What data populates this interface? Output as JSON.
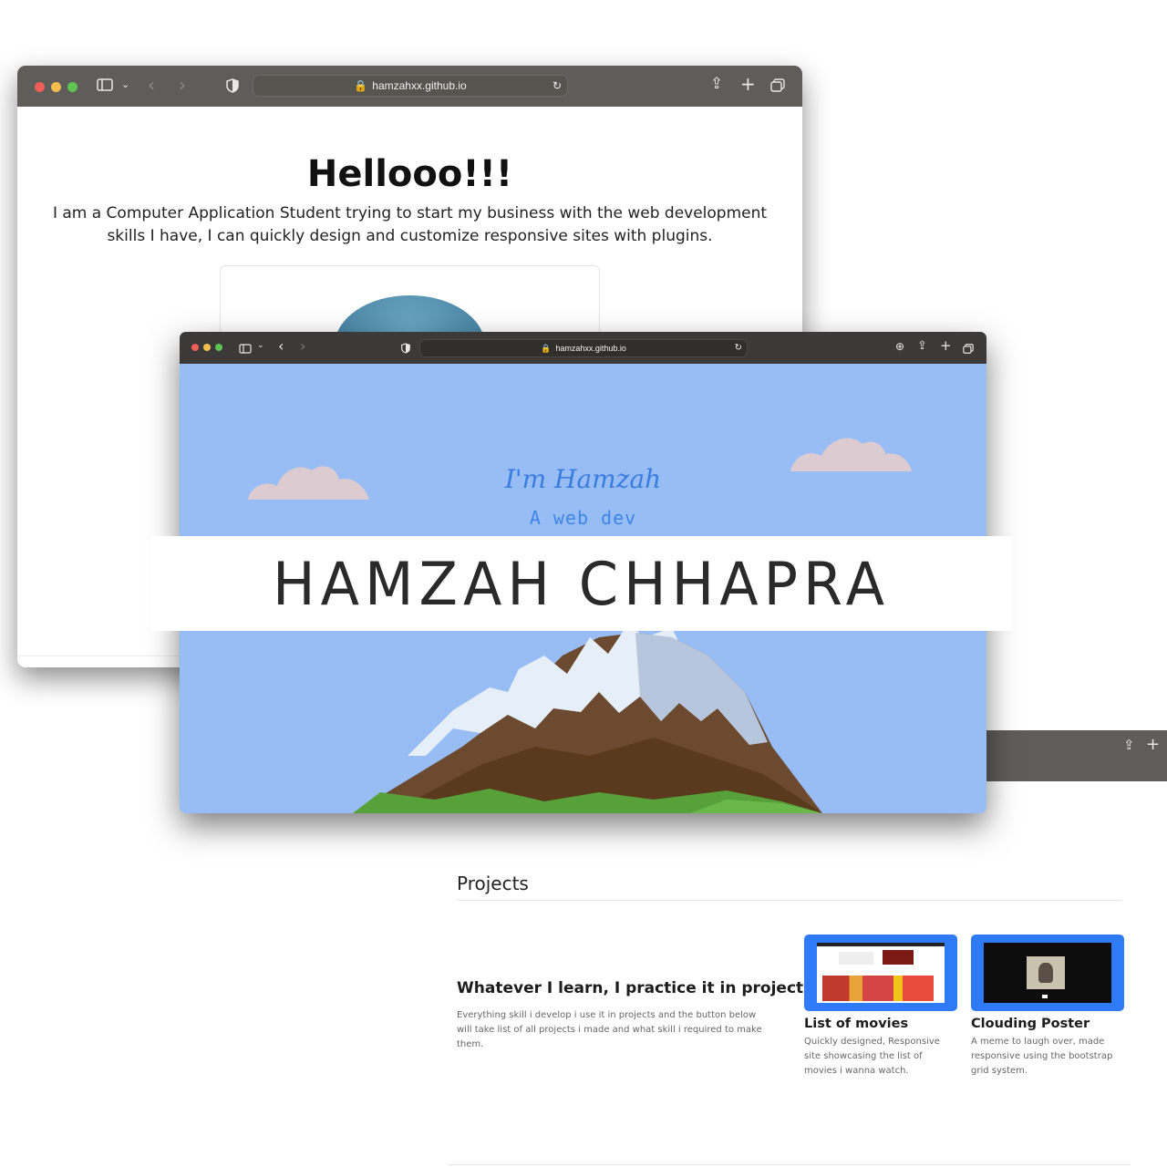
{
  "browser": {
    "url": "hamzahxx.github.io"
  },
  "page_intro": {
    "heading": "Hellooo!!!",
    "intro_text": "I am a Computer Application Student trying to start my business with the web development skills I have, I can quickly design and customize responsive sites with plugins."
  },
  "hero": {
    "greeting": "I'm Hamzah",
    "subtitle": "A web dev"
  },
  "banner": {
    "name": "HAMZAH CHHAPRA"
  },
  "projects": {
    "section_title": "Projects",
    "lead_title": "Whatever I learn, I practice it in projects",
    "lead_desc": "Everything skill i develop i use it in projects and the button below will take list of all projects i made and what skill i required to make them.",
    "items": [
      {
        "title": "List of movies",
        "desc": "Quickly designed, Responsive site showcasing the list of movies i wanna watch."
      },
      {
        "title": "Clouding Poster",
        "desc": "A meme to laugh over, made responsive using the bootstrap grid system."
      }
    ]
  },
  "colors": {
    "toolbar": "#5f5d5a",
    "sky": "#98bdf4",
    "accent_blue": "#2f7bf5"
  },
  "icons": [
    "sidebar-icon",
    "chevron-down-icon",
    "back-icon",
    "forward-icon",
    "shield-icon",
    "lock-icon",
    "reload-icon",
    "share-icon",
    "new-tab-icon",
    "tabs-overview-icon",
    "download-icon"
  ]
}
